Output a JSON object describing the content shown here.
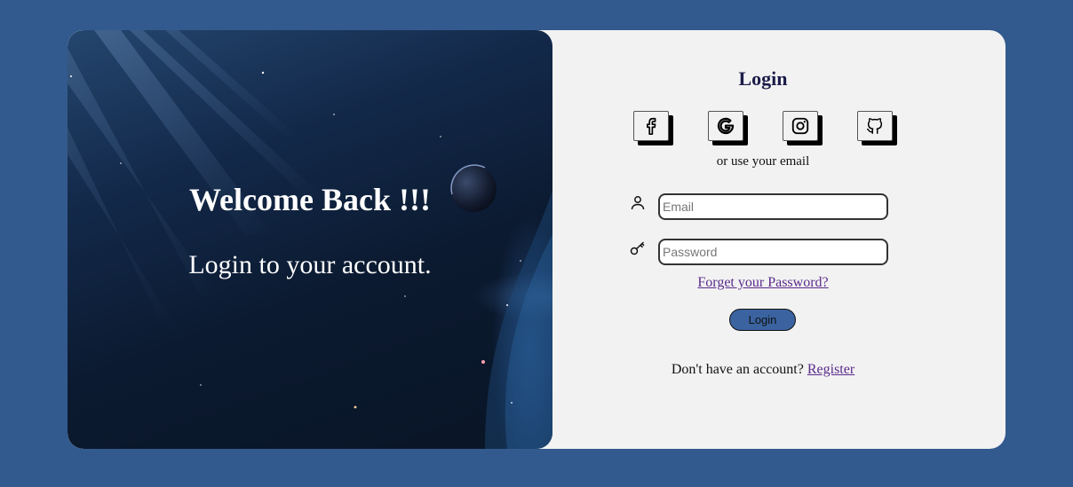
{
  "hero": {
    "title": "Welcome Back !!!",
    "subtitle": "Login to your account."
  },
  "login": {
    "title": "Login",
    "social": [
      {
        "icon": "facebook-icon"
      },
      {
        "icon": "google-icon"
      },
      {
        "icon": "instagram-icon"
      },
      {
        "icon": "github-icon"
      }
    ],
    "or_text": "or use your email",
    "email_placeholder": "Email",
    "password_placeholder": "Password",
    "forget_link": "Forget your Password?",
    "button_label": "Login",
    "register_prompt": "Don't have an account?",
    "register_link": "Register"
  },
  "colors": {
    "page_background": "#335a8e",
    "panel_background": "#f2f2f2",
    "button": "#3a63a0",
    "link": "#5a2a8a"
  }
}
